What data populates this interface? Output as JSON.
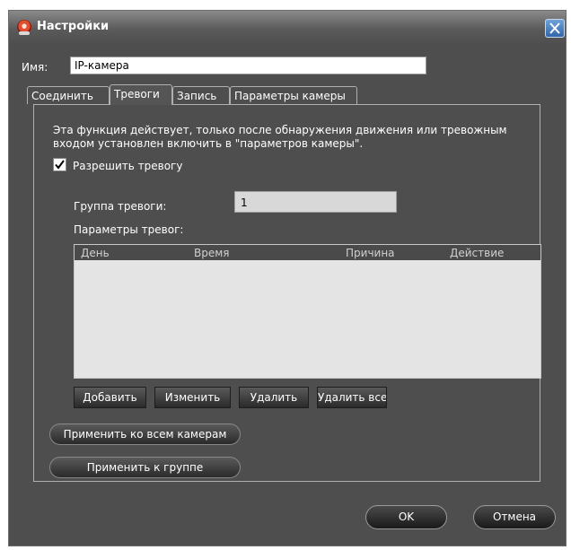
{
  "window": {
    "title": "Настройки"
  },
  "name_field": {
    "label": "Имя:",
    "value": "IP-камера"
  },
  "tabs": [
    {
      "label": "Соединить"
    },
    {
      "label": "Тревоги",
      "active": true
    },
    {
      "label": "Запись"
    },
    {
      "label": "Параметры камеры"
    }
  ],
  "alarm": {
    "info": "Эта функция действует, только после обнаружения движения или тревожным входом установлен включить в \"параметров камеры\".",
    "enable_checkbox": {
      "label": "Разрешить тревогу",
      "checked": true
    },
    "group_label": "Группа тревоги:",
    "group_value": "1",
    "params_label": "Параметры тревог:",
    "table_headers": [
      "День",
      "Время",
      "Причина",
      "Действие"
    ],
    "buttons": {
      "add": "Добавить",
      "edit": "Изменить",
      "delete": "Удалить",
      "delete_all": "Удалить все"
    }
  },
  "apply": {
    "all_cameras": "Применить ко всем камерам",
    "group": "Применить к группе"
  },
  "footer": {
    "ok": "OK",
    "cancel": "Отмена"
  }
}
